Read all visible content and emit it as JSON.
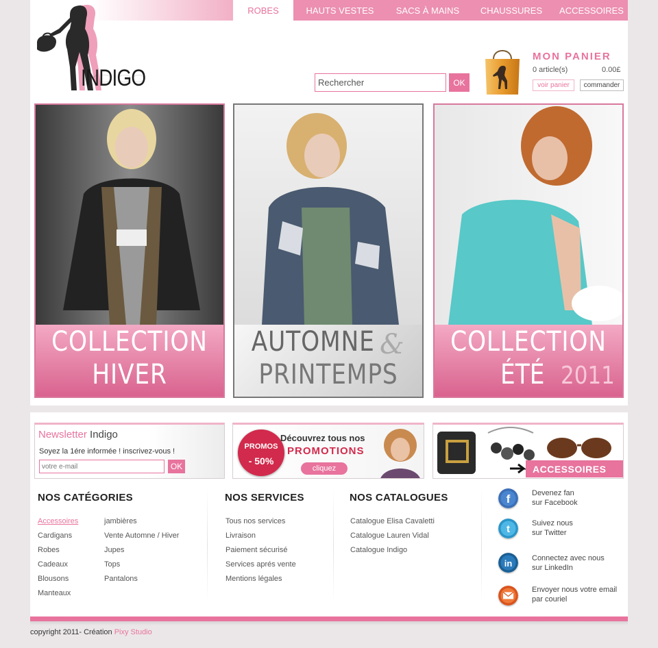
{
  "nav": {
    "items": [
      "ROBES",
      "HAUTS VESTES",
      "SACS À MAINS",
      "CHAUSSURES",
      "ACCESSOIRES"
    ]
  },
  "brand": {
    "logo_text": "INDIGO"
  },
  "search": {
    "placeholder": "Rechercher",
    "button": "OK"
  },
  "cart": {
    "title": "MON PANIER",
    "count": "0 article(s)",
    "total": "0.00£",
    "view_button": "voir panier",
    "order_button": "commander"
  },
  "banners": [
    {
      "line1": "COLLECTION",
      "line2": "HIVER"
    },
    {
      "line1": "AUTOMNE",
      "ampersand": "&",
      "line2": "PRINTEMPS"
    },
    {
      "line1": "COLLECTION",
      "line2": "ÉTÉ",
      "year": "2011"
    }
  ],
  "newsletter": {
    "title": "Newsletter",
    "brand": "Indigo",
    "text": "Soyez la 1ére informée ! inscrivez-vous !",
    "placeholder": "votre e-mail",
    "button": "OK"
  },
  "promo": {
    "badge_top": "PROMOS",
    "badge_bottom": "- 50%",
    "line1": "Découvrez tous nos",
    "line2": "PROMOTIONS",
    "button": "cliquez"
  },
  "accessories_banner": {
    "label": "ACCESSOIRES"
  },
  "categories": {
    "title": "NOS CATÉGORIES",
    "col1": [
      "Accessoires",
      "Cardigans",
      "Robes",
      "Cadeaux",
      "Blousons",
      "Manteaux"
    ],
    "col2": [
      "jambières",
      "Vente Automne / Hiver",
      "Jupes",
      "Tops",
      "Pantalons"
    ]
  },
  "services": {
    "title": "NOS SERVICES",
    "items": [
      "Tous nos services",
      "Livraison",
      "Paiement sécurisé",
      "Services aprés vente",
      "Mentions légales"
    ]
  },
  "catalogues": {
    "title": "NOS CATALOGUES",
    "items": [
      "Catalogue Elisa Cavaletti",
      "Catalogue Lauren Vidal",
      "Catalogue Indigo"
    ]
  },
  "social": [
    {
      "icon": "facebook-icon",
      "line1": "Devenez fan",
      "line2": "sur Facebook"
    },
    {
      "icon": "twitter-icon",
      "line1": "Suivez nous",
      "line2": "sur Twitter"
    },
    {
      "icon": "linkedin-icon",
      "line1": "Connectez avec nous",
      "line2": "sur LinkedIn"
    },
    {
      "icon": "email-icon",
      "line1": "Envoyer nous votre email",
      "line2": "par couriel"
    }
  ],
  "footer": {
    "copyright": "copyright 2011- Création",
    "studio": "Pixy Studio"
  },
  "colors": {
    "accent": "#e8739d",
    "promo_red": "#d22a4c"
  }
}
